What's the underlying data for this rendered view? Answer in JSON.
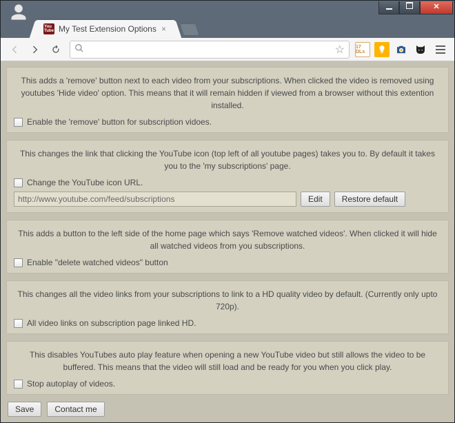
{
  "window": {
    "tab_title": "My Test Extension Options"
  },
  "omnibox": {
    "value": "",
    "placeholder": ""
  },
  "ext_icons": {
    "a_label": "17 DLs",
    "b_label": "•"
  },
  "sections": [
    {
      "desc": "This adds a 'remove' button next to each video from your subscriptions. When clicked the video is removed using youtubes 'Hide video' option. This means that it will remain hidden if viewed from a browser without this extention installed.",
      "checkbox_label": "Enable the 'remove' button for subscription vidoes."
    },
    {
      "desc": "This changes the link that clicking the YouTube icon (top left of all youtube pages) takes you to. By default it takes you to the 'my subscriptions' page.",
      "checkbox_label": "Change the YouTube icon URL.",
      "url_value": "http://www.youtube.com/feed/subscriptions",
      "edit_label": "Edit",
      "restore_label": "Restore default"
    },
    {
      "desc": "This adds a button to the left side of the home page which says 'Remove watched videos'. When clicked it will hide all watched videos from you subscriptions.",
      "checkbox_label": "Enable \"delete watched videos\" button"
    },
    {
      "desc": "This changes all the video links from your subscriptions to link to a HD quality video by default. (Currently only upto 720p).",
      "checkbox_label": "All video links on subscription page linked HD."
    },
    {
      "desc": "This disables YouTubes auto play feature when opening a new YouTube video but still allows the video to be buffered. This means that the video will still load and be ready for you when you click play.",
      "checkbox_label": "Stop autoplay of videos."
    }
  ],
  "footer": {
    "save_label": "Save",
    "contact_label": "Contact me"
  }
}
